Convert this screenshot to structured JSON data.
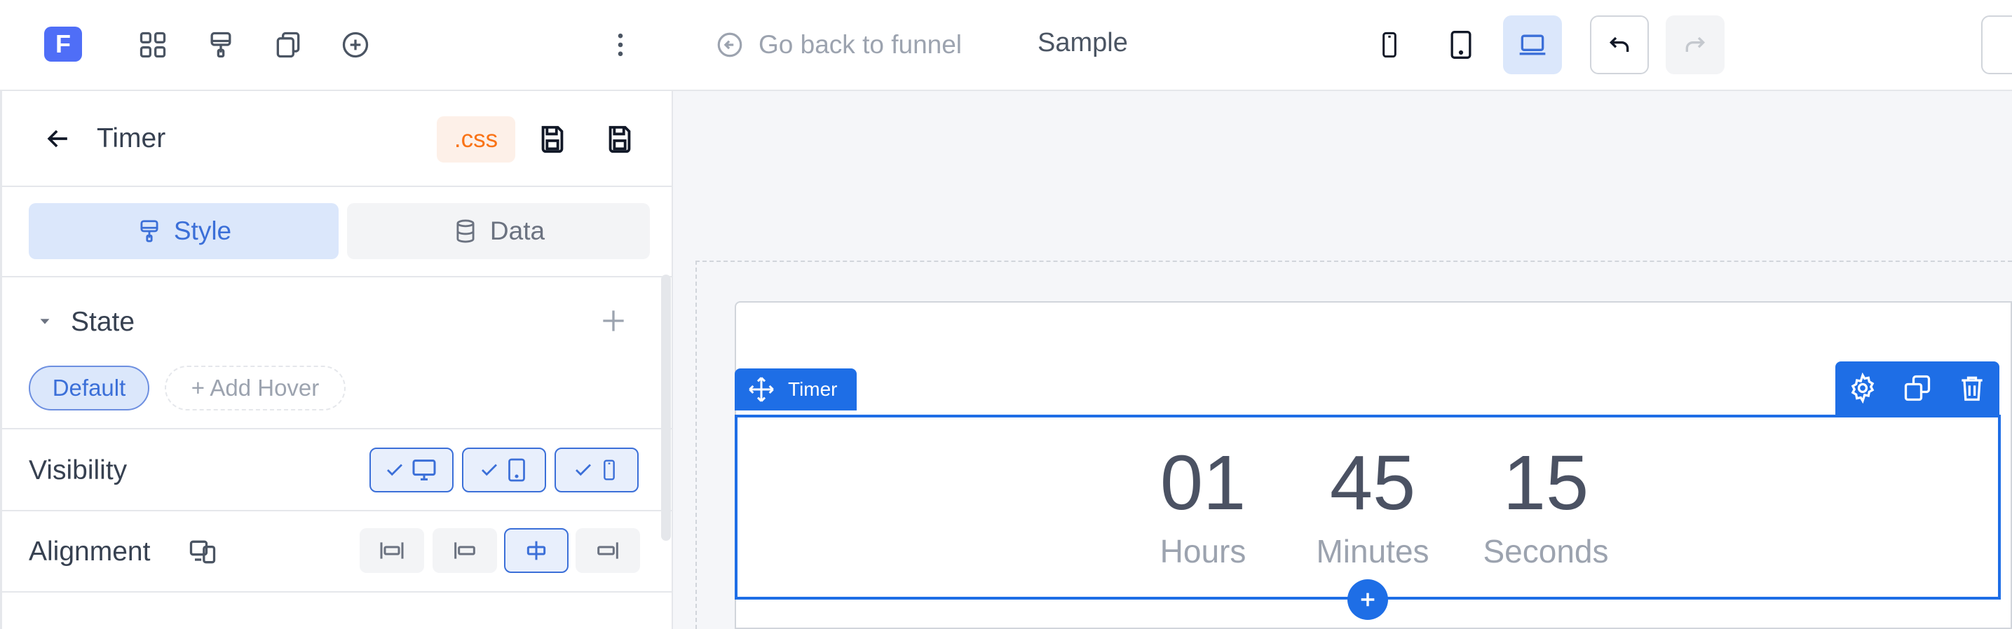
{
  "topbar": {
    "logo_letter": "F",
    "go_back_label": "Go back to funnel",
    "page_name": "Sample",
    "active_device": "desktop"
  },
  "panel": {
    "title": "Timer",
    "css_label": ".css",
    "tabs": [
      {
        "label": "Style",
        "active": true
      },
      {
        "label": "Data",
        "active": false
      }
    ],
    "state": {
      "label": "State",
      "default_label": "Default",
      "add_hover_label": "+ Add Hover"
    },
    "visibility": {
      "label": "Visibility",
      "desktop": true,
      "tablet": true,
      "mobile": true
    },
    "alignment": {
      "label": "Alignment",
      "selected": "center"
    }
  },
  "canvas": {
    "element_tag": "Timer",
    "timer": [
      {
        "value": "01",
        "label": "Hours"
      },
      {
        "value": "45",
        "label": "Minutes"
      },
      {
        "value": "15",
        "label": "Seconds"
      }
    ]
  },
  "colors": {
    "brand": "#4f6ef7",
    "accent": "#1e6ee6",
    "css_orange": "#f97316"
  }
}
